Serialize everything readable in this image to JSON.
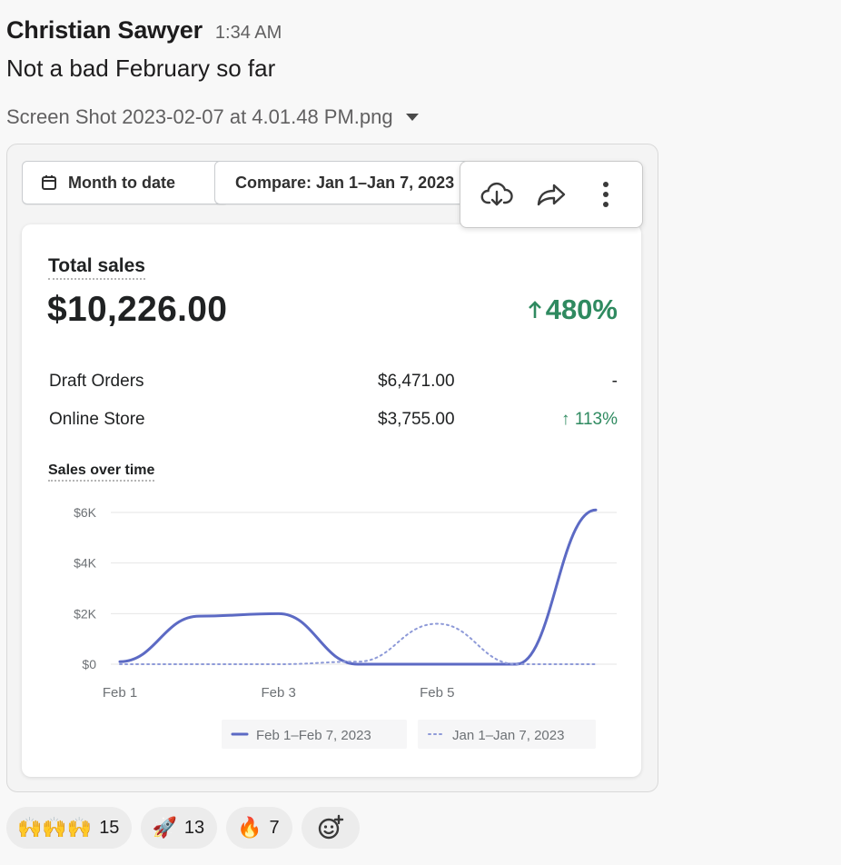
{
  "message": {
    "author": "Christian Sawyer",
    "timestamp": "1:34 AM",
    "text": "Not a bad February so far",
    "file_name": "Screen Shot 2023-02-07 at 4.01.48 PM.png"
  },
  "filters": {
    "month_to_date": "Month to date",
    "compare": "Compare: Jan 1–Jan 7, 2023"
  },
  "toolbar": {
    "download_icon": "cloud-download-icon",
    "share_icon": "share-arrow-icon",
    "more_icon": "vertical-ellipsis-icon"
  },
  "sales": {
    "title": "Total sales",
    "total": "$10,226.00",
    "total_change": "480%",
    "rows": [
      {
        "label": "Draft Orders",
        "value": "$6,471.00",
        "change": "-"
      },
      {
        "label": "Online Store",
        "value": "$3,755.00",
        "change": "113%"
      }
    ],
    "chart_title": "Sales over time",
    "colors": {
      "positive": "#2f8a60",
      "current_series": "#5c6ac4",
      "compare_series": "#8e9ad8"
    }
  },
  "chart_data": {
    "type": "line",
    "title": "Sales over time",
    "x": [
      "Feb 1",
      "Feb 2",
      "Feb 3",
      "Feb 4",
      "Feb 5",
      "Feb 6",
      "Feb 7"
    ],
    "x_tick_labels": [
      "Feb 1",
      "Feb 3",
      "Feb 5"
    ],
    "y_tick_labels": [
      "$0",
      "$2K",
      "$4K",
      "$6K"
    ],
    "ylim": [
      0,
      6000
    ],
    "grid": true,
    "legend_position": "bottom",
    "series": [
      {
        "name": "Feb 1–Feb 7, 2023",
        "values": [
          100,
          1900,
          2000,
          0,
          0,
          0,
          6100
        ],
        "style": "solid",
        "color": "#5c6ac4"
      },
      {
        "name": "Jan 1–Jan 7, 2023",
        "values": [
          0,
          0,
          0,
          100,
          1600,
          0,
          0
        ],
        "style": "dotted",
        "color": "#8e9ad8"
      }
    ]
  },
  "reactions": [
    {
      "emoji": "🙌🙌🙌",
      "count": "15"
    },
    {
      "emoji": "🚀",
      "count": "13"
    },
    {
      "emoji": "🔥",
      "count": "7"
    }
  ]
}
